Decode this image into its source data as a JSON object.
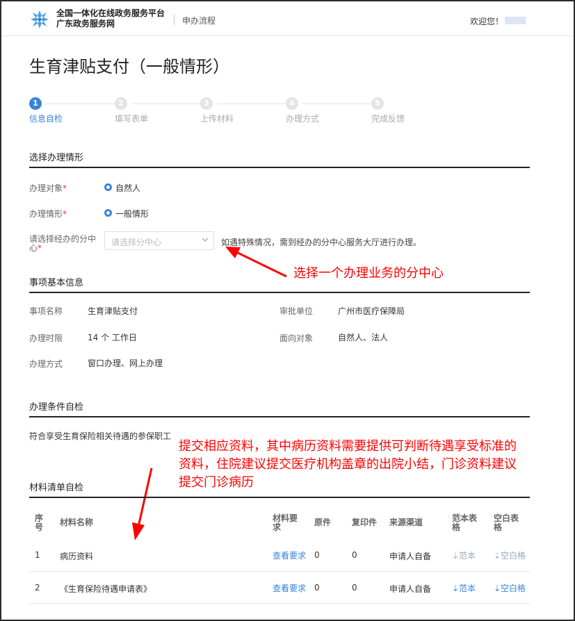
{
  "header": {
    "brand_line1": "全国一体化在线政务服务平台",
    "brand_line2": "广东政务服务网",
    "nav_label": "申办流程",
    "welcome": "欢迎您！",
    "accent": "#3a84d8"
  },
  "page": {
    "title": "生育津贴支付（一般情形）"
  },
  "steps": [
    {
      "num": "1",
      "label": "信息自检",
      "active": true
    },
    {
      "num": "2",
      "label": "填写表单",
      "active": false
    },
    {
      "num": "3",
      "label": "上传材料",
      "active": false
    },
    {
      "num": "4",
      "label": "办理方式",
      "active": false
    },
    {
      "num": "5",
      "label": "完成反馈",
      "active": false
    }
  ],
  "situation": {
    "title": "选择办理情形",
    "target_label": "办理对象",
    "target_value": "自然人",
    "case_label": "办理情形",
    "case_value": "一般情形",
    "center_label_1": "请选择经办的分中",
    "center_label_2": "心",
    "center_placeholder": "请选择分中心",
    "center_hint": "如遇特殊情况，需到经办的分中心服务大厅进行办理。",
    "required_mark": "*"
  },
  "basic": {
    "title": "事项基本信息",
    "name_label": "事项名称",
    "name_value": "生育津贴支付",
    "dept_label": "审批单位",
    "dept_value": "广州市医疗保障局",
    "time_label": "办理时限",
    "time_value": "14 个 工作日",
    "audience_label": "面向对象",
    "audience_value": "自然人、法人",
    "mode_label": "办理方式",
    "mode_value": "窗口办理、网上办理"
  },
  "conditions": {
    "title": "办理条件自检",
    "text": "符合享受生育保险相关待遇的参保职工"
  },
  "materials": {
    "title": "材料清单自检",
    "headers": {
      "seq_1": "序",
      "seq_2": "号",
      "name": "材料名称",
      "req_1": "材料要",
      "req_2": "求",
      "original": "原件",
      "copy": "复印件",
      "source": "来源渠道",
      "sample_1": "范本表",
      "sample_2": "格",
      "blank_1": "空白表",
      "blank_2": "格"
    },
    "rows": [
      {
        "seq": "1",
        "name": "病历资料",
        "req": "查看要求",
        "original": "0",
        "copy": "0",
        "source": "申请人自备",
        "sample": "⇣范本",
        "blank": "⇣空白格"
      },
      {
        "seq": "2",
        "name": "《生育保险待遇申请表》",
        "req": "查看要求",
        "original": "0",
        "copy": "0",
        "source": "申请人自备",
        "sample": "⇣范本",
        "blank": "⇣空白格"
      }
    ]
  },
  "annotations": {
    "select_center": "选择一个办理业务的分中心",
    "materials_line1": "提交相应资料，其中病历资料需要提供可判断待遇享受标准的",
    "materials_line2": "资料，住院建议提交医疗机构盖章的出院小结，门诊资料建议",
    "materials_line3": "提交门诊病历",
    "color": "#ff0000"
  }
}
